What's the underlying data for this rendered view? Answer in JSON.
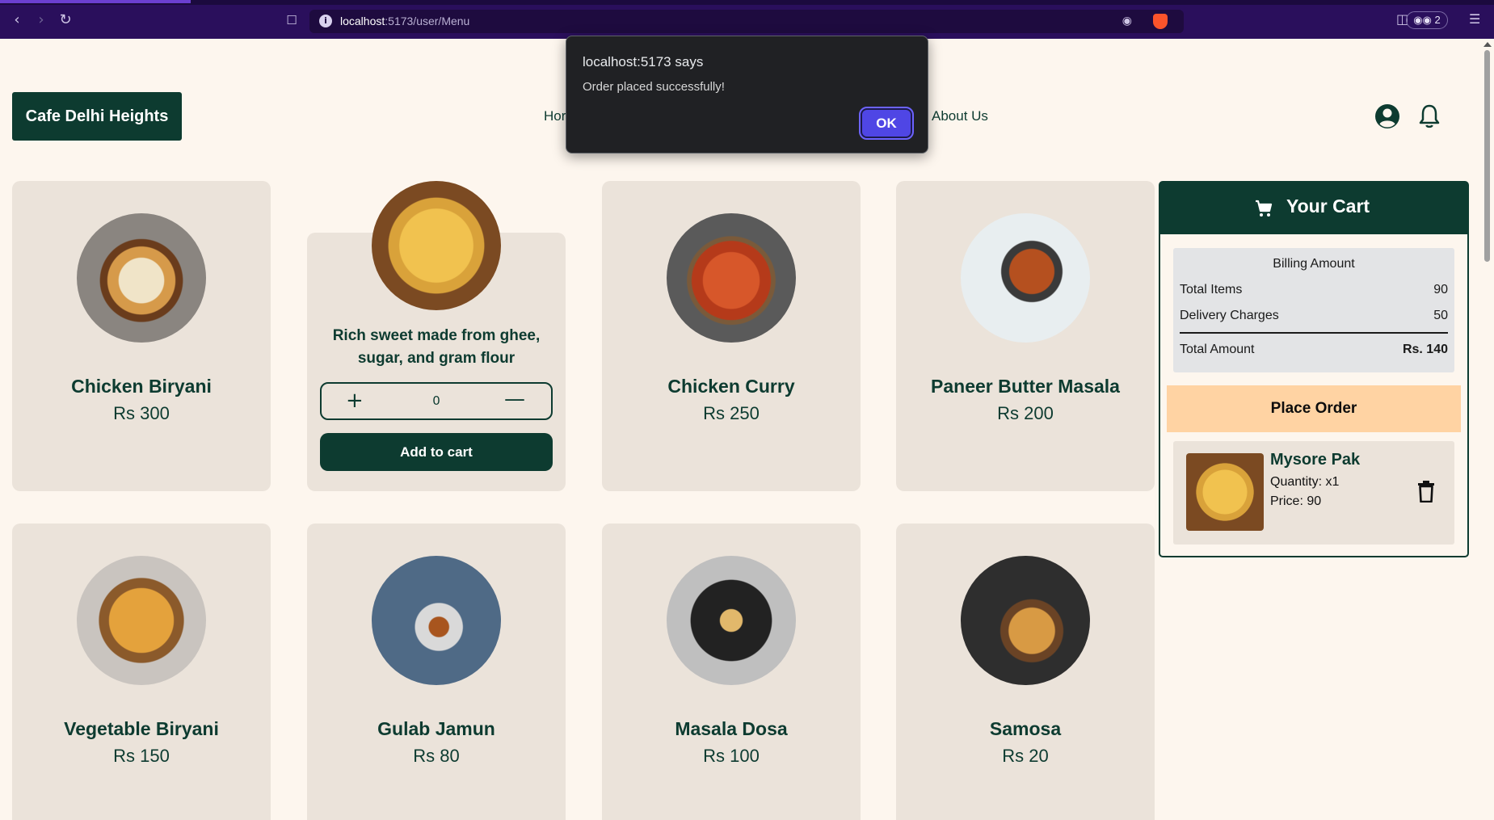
{
  "browser": {
    "url_host": "localhost",
    "url_path": ":5173/user/Menu",
    "tab_count": "2"
  },
  "header": {
    "brand": "Cafe Delhi Heights",
    "nav_home": "Hor",
    "nav_about": "About Us"
  },
  "alert": {
    "title": "localhost:5173 says",
    "message": "Order placed successfully!",
    "ok_label": "OK"
  },
  "menu": {
    "items": [
      {
        "name": "Chicken Biryani",
        "price": "Rs 300"
      },
      {
        "description": "Rich sweet made from ghee, sugar, and gram flour",
        "quantity": "0",
        "add_label": "Add to cart"
      },
      {
        "name": "Chicken Curry",
        "price": "Rs 250"
      },
      {
        "name": "Paneer Butter Masala",
        "price": "Rs 200"
      },
      {
        "name": "Vegetable Biryani",
        "price": "Rs 150"
      },
      {
        "name": "Gulab Jamun",
        "price": "Rs 80"
      },
      {
        "name": "Masala Dosa",
        "price": "Rs 100"
      },
      {
        "name": "Samosa",
        "price": "Rs 20"
      }
    ]
  },
  "cart": {
    "title": "Your Cart",
    "billing": {
      "heading": "Billing Amount",
      "total_items_label": "Total Items",
      "total_items_value": "90",
      "delivery_label": "Delivery Charges",
      "delivery_value": "50",
      "total_label": "Total Amount",
      "total_value": "Rs. 140"
    },
    "place_order_label": "Place Order",
    "items": [
      {
        "name": "Mysore Pak",
        "quantity": "Quantity: x1",
        "price": "Price: 90"
      }
    ]
  },
  "colors": {
    "brand_green": "#0d3b30",
    "page_bg": "#fdf6ee",
    "card_bg": "#ebe3da",
    "place_order_bg": "#ffd3a3",
    "ok_button": "#4f46e5"
  }
}
